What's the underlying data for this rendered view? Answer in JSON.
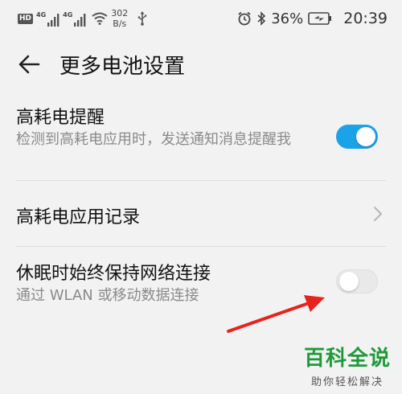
{
  "status_bar": {
    "hd_label": "HD",
    "network_tag_1": "4G",
    "network_tag_2": "4G",
    "speed_value": "302",
    "speed_unit": "B/s",
    "battery_percent": "36%",
    "time": "20:39",
    "icons": [
      "hd-icon",
      "signal-icon",
      "signal-icon",
      "wifi-icon",
      "usb-icon",
      "alarm-icon",
      "bluetooth-icon",
      "battery-icon"
    ]
  },
  "header": {
    "title": "更多电池设置"
  },
  "settings": [
    {
      "title": "高耗电提醒",
      "description": "检测到高耗电应用时，发送通知消息提醒我",
      "control": "toggle",
      "enabled": true
    },
    {
      "title": "高耗电应用记录",
      "control": "chevron"
    },
    {
      "title": "休眠时始终保持网络连接",
      "description": "通过 WLAN 或移动数据连接",
      "control": "toggle",
      "enabled": false
    }
  ],
  "watermark": {
    "main": "百科全说",
    "sub": "助你轻松解决"
  },
  "colors": {
    "accent": "#1aa3e6",
    "annotation_arrow": "#e8231f",
    "watermark_green": "#1f9a3a"
  }
}
